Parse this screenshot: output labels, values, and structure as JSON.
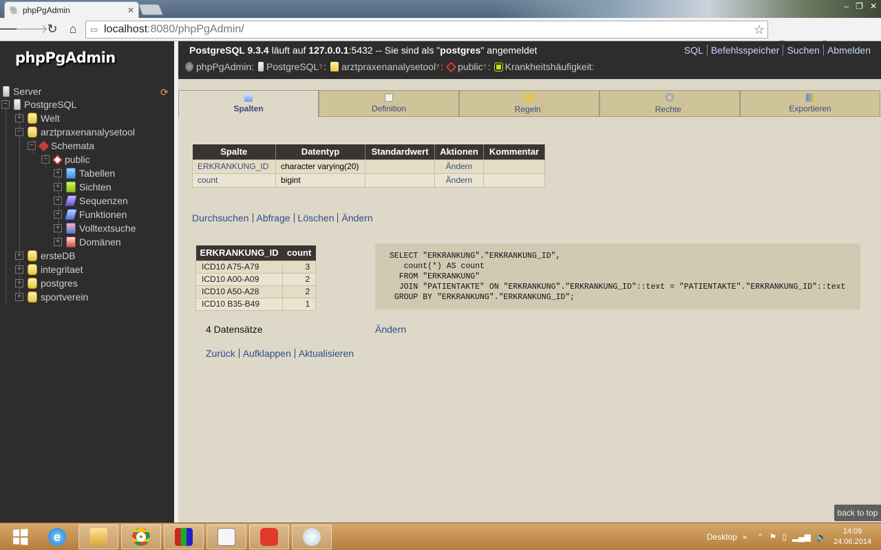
{
  "browser": {
    "tab_title": "phpPgAdmin",
    "tab_close": "✕",
    "url_host": "localhost",
    "url_rest": ":8080/phpPgAdmin/",
    "window_buttons": [
      "–",
      "❐",
      "✕"
    ]
  },
  "sidebar": {
    "logo": "phpPgAdmin",
    "tree": [
      {
        "label": "Server",
        "icon": "server-icon"
      },
      {
        "label": "PostgreSQL",
        "icon": "postgres-icon"
      },
      {
        "label": "Welt",
        "icon": "database-icon"
      },
      {
        "label": "arztpraxenanalysetool",
        "icon": "database-icon"
      },
      {
        "label": "Schemata",
        "icon": "schemas-icon"
      },
      {
        "label": "public",
        "icon": "schema-icon"
      },
      {
        "label": "Tabellen",
        "icon": "tables-icon"
      },
      {
        "label": "Sichten",
        "icon": "views-icon"
      },
      {
        "label": "Sequenzen",
        "icon": "sequences-icon"
      },
      {
        "label": "Funktionen",
        "icon": "functions-icon"
      },
      {
        "label": "Volltextsuche",
        "icon": "fulltext-icon"
      },
      {
        "label": "Domänen",
        "icon": "domains-icon"
      },
      {
        "label": "ersteDB",
        "icon": "database-icon"
      },
      {
        "label": "integritaet",
        "icon": "database-icon"
      },
      {
        "label": "postgres",
        "icon": "database-icon"
      },
      {
        "label": "sportverein",
        "icon": "database-icon"
      }
    ]
  },
  "topbar": {
    "server_name": "PostgreSQL 9.3.4",
    "runs_on": " läuft auf ",
    "host": "127.0.0.1",
    "port_text": ":5432 -- Sie sind als \"",
    "user": "postgres",
    "logged_in": "\" angemeldet",
    "links": [
      "SQL",
      "Befehlsspeicher",
      "Suchen",
      "Abmelden"
    ]
  },
  "breadcrumb": {
    "items": [
      "phpPgAdmin:",
      "PostgreSQL",
      "arztpraxenanalysetool",
      "public",
      "Krankheitshäufigkeit"
    ],
    "help": "?"
  },
  "tabs": [
    {
      "label": "Spalten",
      "active": true,
      "help": ""
    },
    {
      "label": "Definition",
      "active": false,
      "help": ""
    },
    {
      "label": "Regeln",
      "active": false,
      "help": "?"
    },
    {
      "label": "Rechte",
      "active": false,
      "help": "?"
    },
    {
      "label": "Exportieren",
      "active": false,
      "help": ""
    }
  ],
  "columns_table": {
    "headers": [
      "Spalte",
      "Datentyp",
      "Standardwert",
      "Aktionen",
      "Kommentar"
    ],
    "rows": [
      {
        "name": "ERKRANKUNG_ID",
        "type": "character varying(20)",
        "default": "",
        "action": "Ändern",
        "comment": ""
      },
      {
        "name": "count",
        "type": "bigint",
        "default": "",
        "action": "Ändern",
        "comment": ""
      }
    ]
  },
  "view_actions": [
    "Durchsuchen",
    "Abfrage",
    "Löschen",
    "Ändern"
  ],
  "result_table": {
    "headers": [
      "ERKRANKUNG_ID",
      "count"
    ],
    "rows": [
      {
        "id": "ICD10 A75-A79",
        "count": "3"
      },
      {
        "id": "ICD10 A00-A09",
        "count": "2"
      },
      {
        "id": "ICD10 A50-A28",
        "count": "2"
      },
      {
        "id": "ICD10 B35-B49",
        "count": "1"
      }
    ]
  },
  "definition_sql": " SELECT \"ERKRANKUNG\".\"ERKRANKUNG_ID\",\n    count(*) AS count\n   FROM \"ERKRANKUNG\"\n   JOIN \"PATIENTAKTE\" ON \"ERKRANKUNG\".\"ERKRANKUNG_ID\"::text = \"PATIENTAKTE\".\"ERKRANKUNG_ID\"::text\n  GROUP BY \"ERKRANKUNG\".\"ERKRANKUNG_ID\";",
  "record_count": "4 Datensätze",
  "definition_change": "Ändern",
  "bottom_actions": [
    "Zurück",
    "Aufklappen",
    "Aktualisieren"
  ],
  "back_to_top": "back to top",
  "taskbar": {
    "desktop_label": "Desktop",
    "time": "14:09",
    "date": "24.06.2014"
  }
}
